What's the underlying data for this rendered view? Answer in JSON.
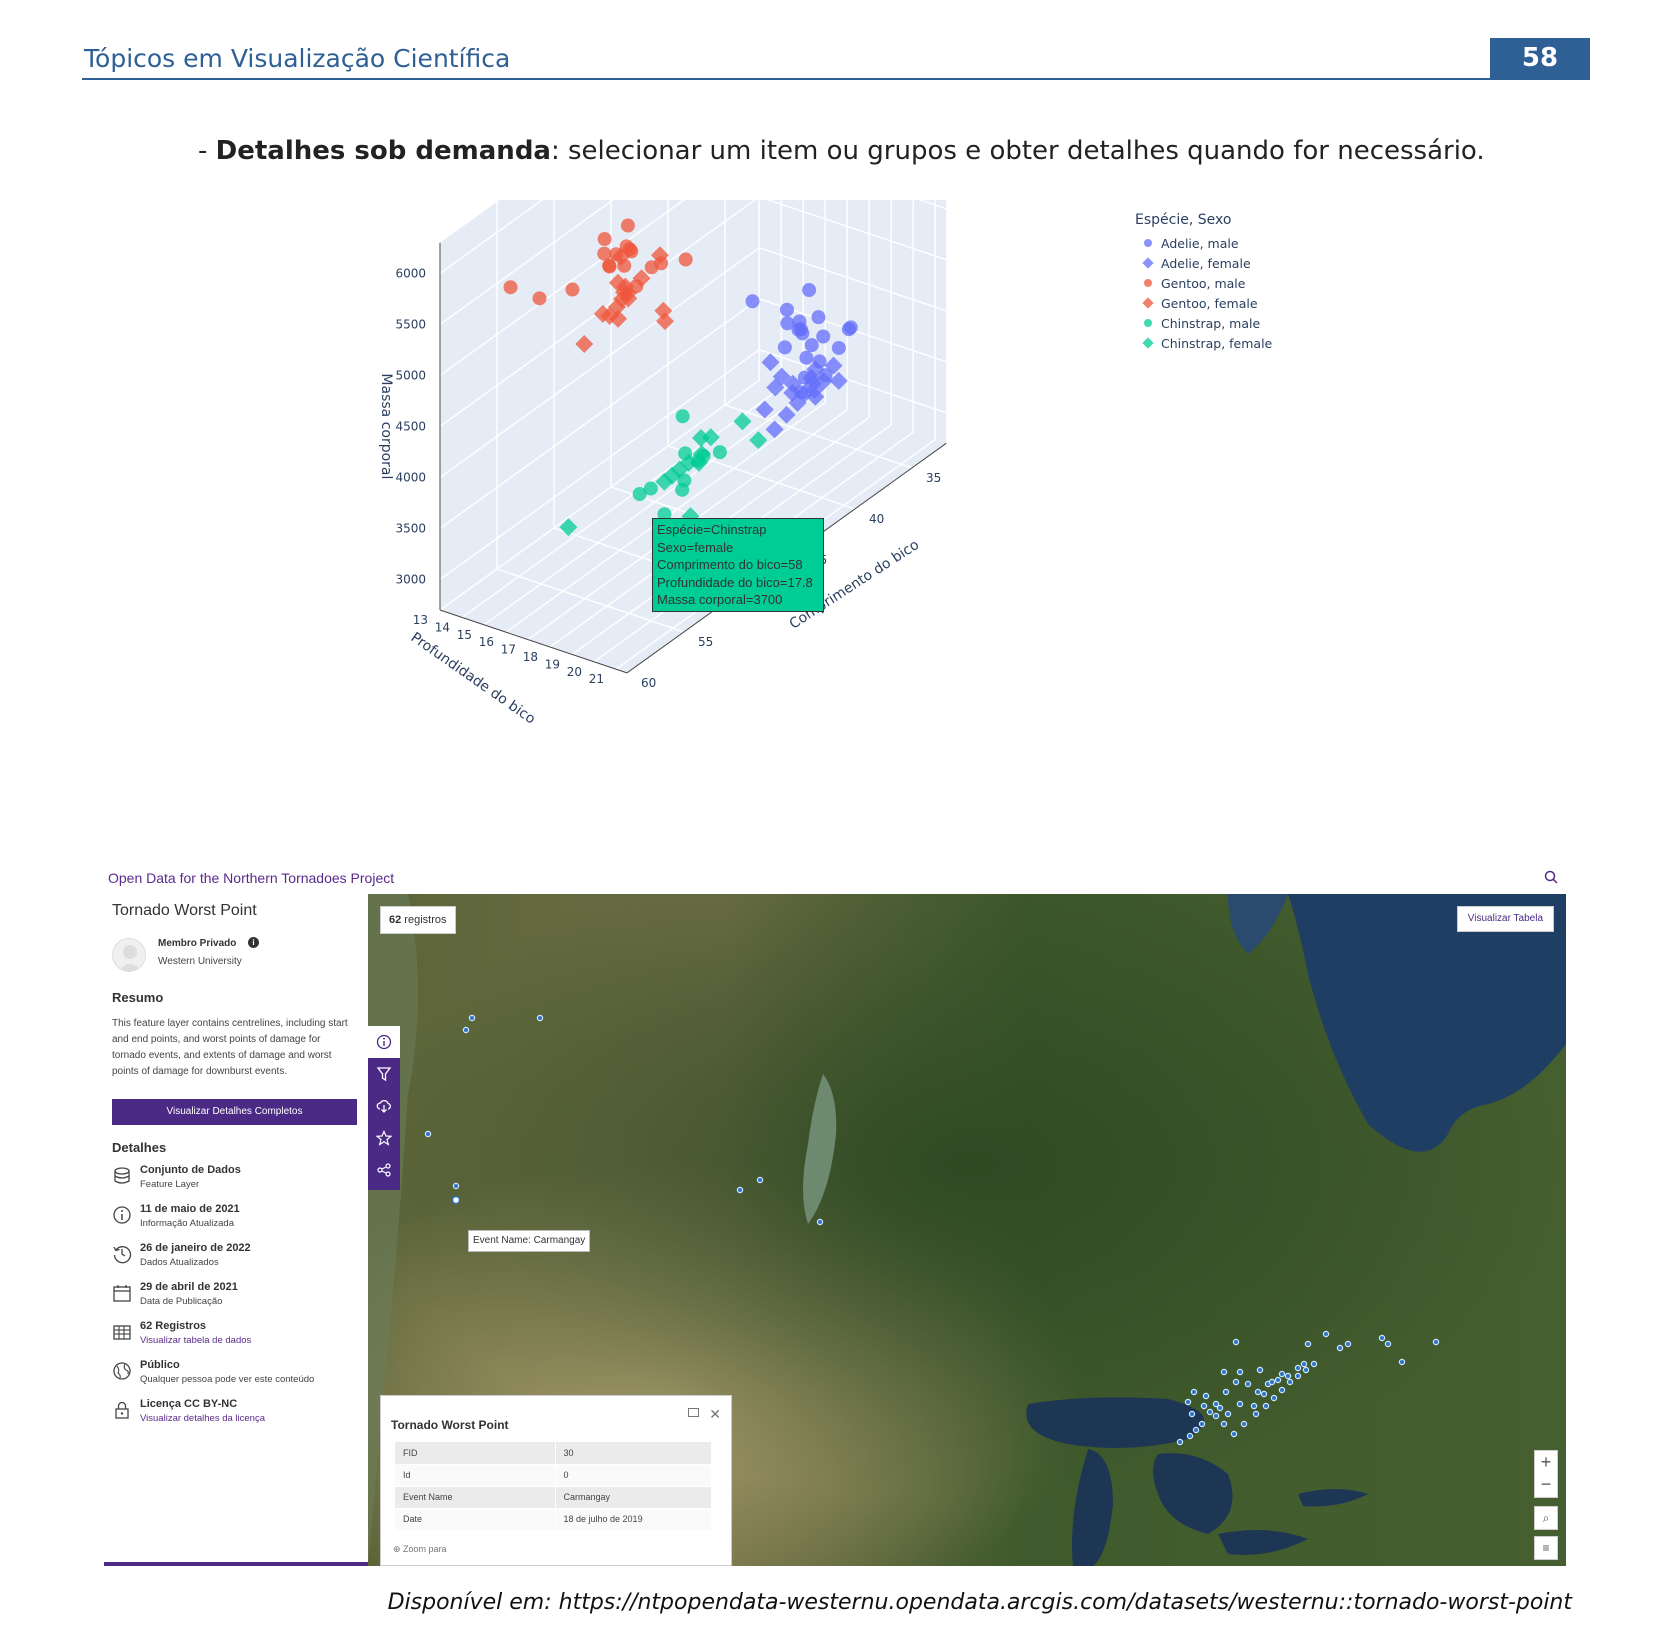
{
  "header": {
    "title": "Tópicos em Visualização Científica",
    "page_number": "58"
  },
  "intro": {
    "bullet": "- ",
    "bold": "Detalhes sob demanda",
    "rest": ": selecionar um item ou grupos e obter detalhes quando for necessário."
  },
  "chart_data": {
    "type": "scatter",
    "title": "",
    "xlabel": "Profundidade do bico",
    "ylabel": "Comprimento do bico",
    "zlabel": "Massa corporal",
    "x_ticks": [
      "13",
      "14",
      "15",
      "16",
      "17",
      "18",
      "19",
      "20",
      "21"
    ],
    "y_ticks": [
      "35",
      "40",
      "45",
      "50",
      "55",
      "60"
    ],
    "z_ticks": [
      "3000",
      "3500",
      "4000",
      "4500",
      "5000",
      "5500",
      "6000"
    ],
    "xlim": [
      13,
      21.5
    ],
    "ylim": [
      32,
      60
    ],
    "zlim": [
      2700,
      6300
    ],
    "legend_title": "Espécie, Sexo",
    "legend_position": "right",
    "series": [
      {
        "name": "Adelie, male",
        "symbol": "circle",
        "color": "#636efa",
        "points": [
          [
            18.9,
            39.6,
            4200
          ],
          [
            19.2,
            40.3,
            3700
          ],
          [
            20.6,
            38.8,
            4300
          ],
          [
            18.7,
            37.8,
            4200
          ],
          [
            19.5,
            41.1,
            4400
          ],
          [
            18.3,
            38.7,
            4200
          ],
          [
            19.0,
            39.2,
            4600
          ],
          [
            19.6,
            42.3,
            4700
          ],
          [
            18.9,
            36.4,
            3800
          ],
          [
            20.2,
            40.6,
            4100
          ],
          [
            19.4,
            42.1,
            4300
          ],
          [
            19.7,
            36.9,
            4100
          ],
          [
            21.2,
            42.0,
            4150
          ],
          [
            18.5,
            43.2,
            4775
          ],
          [
            19.1,
            41.3,
            4450
          ],
          [
            17.8,
            37.6,
            4000
          ],
          [
            18.6,
            38.2,
            3950
          ],
          [
            20.0,
            41.5,
            4000
          ],
          [
            19.9,
            39.7,
            4250
          ],
          [
            18.1,
            37.7,
            3750
          ]
        ]
      },
      {
        "name": "Adelie, female",
        "symbol": "diamond",
        "color": "#636efa",
        "points": [
          [
            17.4,
            39.5,
            3800
          ],
          [
            18.0,
            40.3,
            3250
          ],
          [
            17.8,
            36.7,
            3450
          ],
          [
            19.3,
            39.3,
            3650
          ],
          [
            17.6,
            38.9,
            3625
          ],
          [
            18.4,
            35.9,
            3550
          ],
          [
            17.2,
            37.2,
            3300
          ],
          [
            18.1,
            36.2,
            3400
          ],
          [
            17.9,
            38.1,
            3325
          ],
          [
            17.0,
            35.0,
            3200
          ],
          [
            16.6,
            36.0,
            3250
          ],
          [
            18.3,
            37.3,
            3350
          ],
          [
            17.1,
            38.5,
            3450
          ],
          [
            19.0,
            36.6,
            3500
          ],
          [
            16.9,
            34.6,
            3300
          ],
          [
            17.5,
            40.2,
            3400
          ],
          [
            18.7,
            39.0,
            3550
          ],
          [
            17.3,
            37.9,
            3150
          ]
        ]
      },
      {
        "name": "Gentoo, male",
        "symbol": "circle",
        "color": "#ef553b",
        "points": [
          [
            16.3,
            50.0,
            5700
          ],
          [
            15.3,
            50.0,
            5700
          ],
          [
            15.2,
            47.6,
            5400
          ],
          [
            16.0,
            49.0,
            5550
          ],
          [
            17.1,
            49.2,
            6300
          ],
          [
            16.1,
            49.5,
            5850
          ],
          [
            15.7,
            50.8,
            5650
          ],
          [
            16.2,
            51.3,
            5600
          ],
          [
            16.8,
            52.5,
            5750
          ],
          [
            15.9,
            46.2,
            5200
          ],
          [
            16.5,
            45.2,
            5200
          ],
          [
            15.0,
            48.4,
            5400
          ],
          [
            16.4,
            50.4,
            5550
          ],
          [
            15.4,
            55.9,
            5600
          ],
          [
            16.0,
            59.6,
            6050
          ],
          [
            17.0,
            50.5,
            5400
          ],
          [
            14.9,
            45.1,
            5000
          ],
          [
            15.6,
            53.4,
            5500
          ]
        ]
      },
      {
        "name": "Gentoo, female",
        "symbol": "diamond",
        "color": "#ef553b",
        "points": [
          [
            13.2,
            46.1,
            4500
          ],
          [
            13.7,
            48.7,
            4450
          ],
          [
            14.1,
            46.5,
            4550
          ],
          [
            13.8,
            45.4,
            4700
          ],
          [
            14.5,
            43.3,
            4400
          ],
          [
            14.2,
            45.8,
            4700
          ],
          [
            13.9,
            42.0,
            4150
          ],
          [
            14.4,
            46.2,
            4800
          ],
          [
            13.5,
            45.1,
            5000
          ],
          [
            14.0,
            46.4,
            4650
          ],
          [
            13.3,
            42.9,
            4600
          ],
          [
            14.8,
            47.5,
            4875
          ],
          [
            13.6,
            44.9,
            4700
          ],
          [
            14.3,
            46.9,
            4950
          ],
          [
            13.1,
            40.9,
            4650
          ],
          [
            14.6,
            48.2,
            4750
          ]
        ]
      },
      {
        "name": "Chinstrap, male",
        "symbol": "circle",
        "color": "#00cc96",
        "points": [
          [
            19.8,
            50.0,
            3900
          ],
          [
            19.5,
            51.3,
            3650
          ],
          [
            18.8,
            52.7,
            3725
          ],
          [
            19.6,
            51.3,
            3750
          ],
          [
            20.0,
            52.0,
            4100
          ],
          [
            20.8,
            50.5,
            4050
          ],
          [
            19.4,
            49.7,
            3800
          ],
          [
            18.9,
            51.7,
            3400
          ],
          [
            19.9,
            55.8,
            4000
          ],
          [
            20.3,
            52.8,
            4550
          ]
        ]
      },
      {
        "name": "Chinstrap, female",
        "symbol": "diamond",
        "color": "#00cc96",
        "points": [
          [
            17.9,
            46.5,
            3500
          ],
          [
            17.3,
            45.4,
            3525
          ],
          [
            17.8,
            58.0,
            3700
          ],
          [
            17.0,
            45.9,
            3300
          ],
          [
            18.4,
            42.5,
            3350
          ],
          [
            17.6,
            46.9,
            2900
          ],
          [
            17.1,
            45.2,
            3250
          ],
          [
            16.6,
            46.6,
            3200
          ],
          [
            18.2,
            43.5,
            3600
          ],
          [
            17.5,
            49.0,
            3400
          ],
          [
            17.9,
            45.7,
            3600
          ],
          [
            17.0,
            46.7,
            3300
          ]
        ]
      }
    ]
  },
  "hover": {
    "lines": [
      "Espécie=Chinstrap",
      "Sexo=female",
      "Comprimento do bico=58",
      "Profundidade do bico=17.8",
      "Massa corporal=3700"
    ]
  },
  "portal": {
    "site_title": "Open Data for the Northern Tornadoes Project",
    "dataset_title": "Tornado Worst Point",
    "owner_name": "Membro Privado",
    "owner_org": "Western University",
    "summary_heading": "Resumo",
    "summary": "This feature layer contains centrelines, including start and end points, and worst points of damage for tornado events, and extents of damage and worst points of damage for downburst events.",
    "details_button": "Visualizar Detalhes Completos",
    "details_heading": "Detalhes",
    "details": [
      {
        "icon": "database-icon",
        "main": "Conjunto de Dados",
        "sub": "Feature Layer",
        "link": false
      },
      {
        "icon": "info-icon",
        "main": "11 de maio de 2021",
        "sub": "Informação Atualizada",
        "link": false
      },
      {
        "icon": "history-icon",
        "main": "26 de janeiro de 2022",
        "sub": "Dados Atualizados",
        "link": false
      },
      {
        "icon": "calendar-icon",
        "main": "29 de abril de 2021",
        "sub": "Data de Publicação",
        "link": false
      },
      {
        "icon": "table-icon",
        "main": "62 Registros",
        "sub": "Visualizar tabela de dados",
        "link": true
      },
      {
        "icon": "globe-icon",
        "main": "Público",
        "sub": "Qualquer pessoa pode ver este conteúdo",
        "link": false
      },
      {
        "icon": "lock-icon",
        "main": "Licença CC BY-NC",
        "sub": "Visualizar detalhes da licença",
        "link": true
      }
    ],
    "record_count": "62",
    "record_word": " registros",
    "table_button": "Visualizar Tabela",
    "map_tooltip": "Event Name: Carmangay",
    "popup": {
      "title": "Tornado Worst Point",
      "rows": [
        {
          "k": "FID",
          "v": "30"
        },
        {
          "k": "Id",
          "v": "0"
        },
        {
          "k": "Event Name",
          "v": "Carmangay"
        },
        {
          "k": "Date",
          "v": "18 de julho de 2019"
        }
      ],
      "zoom_label": "Zoom para"
    },
    "map_controls": {
      "zoom_in": "+",
      "zoom_out": "−"
    }
  },
  "footer": "Disponível em: https://ntpopendata-westernu.opendata.arcgis.com/datasets/westernu::tornado-worst-point"
}
